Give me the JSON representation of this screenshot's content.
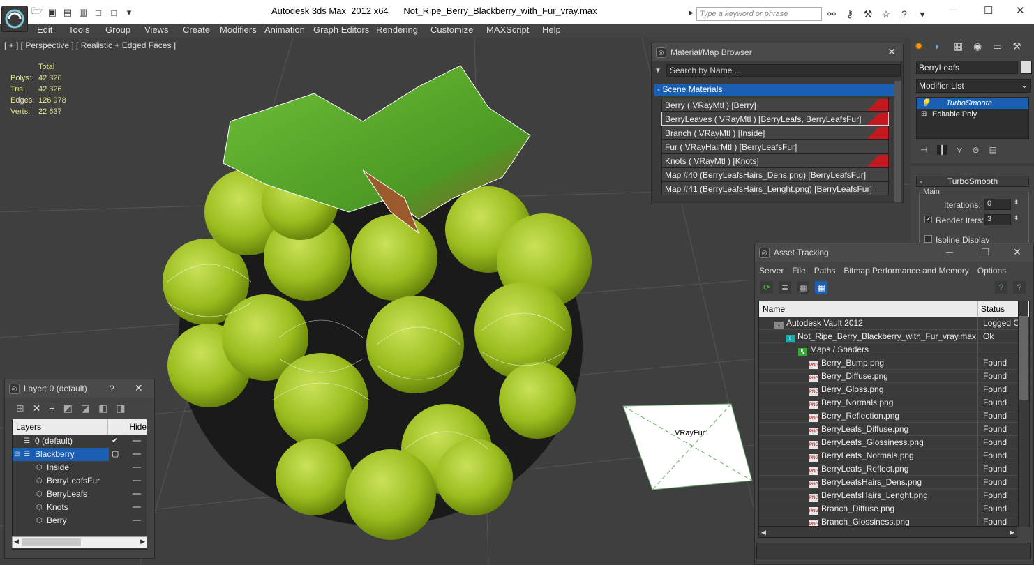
{
  "window": {
    "title": "Autodesk 3ds Max  2012 x64      Not_Ripe_Berry_Blackberry_with_Fur_vray.max",
    "search_placeholder": "Type a keyword or phrase"
  },
  "menu": [
    "Edit",
    "Tools",
    "Group",
    "Views",
    "Create",
    "Modifiers",
    "Animation",
    "Graph Editors",
    "Rendering",
    "Customize",
    "MAXScript",
    "Help"
  ],
  "viewport": {
    "label": "[ + ] [ Perspective ] [ Realistic + Edged Faces ]",
    "stats_header": "Total",
    "stats": [
      {
        "k": "Polys:",
        "v": "42 326"
      },
      {
        "k": "Tris:",
        "v": "42 326"
      },
      {
        "k": "Edges:",
        "v": "126 978"
      },
      {
        "k": "Verts:",
        "v": "22 637"
      }
    ],
    "vrayfur_label": "VRayFur"
  },
  "material_browser": {
    "title": "Material/Map Browser",
    "search_placeholder": "Search by Name ...",
    "section": "- Scene Materials",
    "items": [
      "Berry  ( VRayMtl ) [Berry]",
      "BerryLeaves  ( VRayMtl ) [BerryLeafs, BerryLeafsFur]",
      "Branch  ( VRayMtl ) [Inside]",
      "Fur  ( VRayHairMtl ) [BerryLeafsFur]",
      "Knots  ( VRayMtl ) [Knots]",
      "Map #40 (BerryLeafsHairs_Dens.png) [BerryLeafsFur]",
      "Map #41 (BerryLeafsHairs_Lenght.png) [BerryLeafsFur]"
    ]
  },
  "command_panel": {
    "object_name": "BerryLeafs",
    "modifier_list": "Modifier List",
    "stack": [
      "TurboSmooth",
      "Editable Poly"
    ],
    "rollout": "TurboSmooth",
    "group": "Main",
    "iterations_label": "Iterations:",
    "iterations_value": "0",
    "render_iters_label": "Render Iters:",
    "render_iters_value": "3",
    "isoline_label": "Isoline Display"
  },
  "asset_tracking": {
    "title": "Asset Tracking",
    "menu": [
      "Server",
      "File",
      "Paths",
      "Bitmap Performance and Memory",
      "Options"
    ],
    "col_name": "Name",
    "col_status": "Status",
    "rows": [
      {
        "name": "Autodesk Vault 2012",
        "status": "Logged O",
        "indent": 22
      },
      {
        "name": "Not_Ripe_Berry_Blackberry_with_Fur_vray.max",
        "status": "Ok",
        "indent": 38
      },
      {
        "name": "Maps / Shaders",
        "status": "",
        "indent": 56
      },
      {
        "name": "Berry_Bump.png",
        "status": "Found",
        "indent": 72
      },
      {
        "name": "Berry_Diffuse.png",
        "status": "Found",
        "indent": 72
      },
      {
        "name": "Berry_Gloss.png",
        "status": "Found",
        "indent": 72
      },
      {
        "name": "Berry_Normals.png",
        "status": "Found",
        "indent": 72
      },
      {
        "name": "Berry_Reflection.png",
        "status": "Found",
        "indent": 72
      },
      {
        "name": "BerryLeafs_Diffuse.png",
        "status": "Found",
        "indent": 72
      },
      {
        "name": "BerryLeafs_Glossiness.png",
        "status": "Found",
        "indent": 72
      },
      {
        "name": "BerryLeafs_Normals.png",
        "status": "Found",
        "indent": 72
      },
      {
        "name": "BerryLeafs_Reflect.png",
        "status": "Found",
        "indent": 72
      },
      {
        "name": "BerryLeafsHairs_Dens.png",
        "status": "Found",
        "indent": 72
      },
      {
        "name": "BerryLeafsHairs_Lenght.png",
        "status": "Found",
        "indent": 72
      },
      {
        "name": "Branch_Diffuse.png",
        "status": "Found",
        "indent": 72
      },
      {
        "name": "Branch_Glossiness.png",
        "status": "Found",
        "indent": 72
      }
    ]
  },
  "layer_panel": {
    "title": "Layer: 0 (default)",
    "help": "?",
    "col_layers": "Layers",
    "col_hide": "Hide",
    "rows": [
      {
        "name": "0 (default)",
        "level": 1
      },
      {
        "name": "Blackberry",
        "level": 1
      },
      {
        "name": "Inside",
        "level": 2
      },
      {
        "name": "BerryLeafsFur",
        "level": 2
      },
      {
        "name": "BerryLeafs",
        "level": 2
      },
      {
        "name": "Knots",
        "level": 2
      },
      {
        "name": "Berry",
        "level": 2
      }
    ]
  }
}
